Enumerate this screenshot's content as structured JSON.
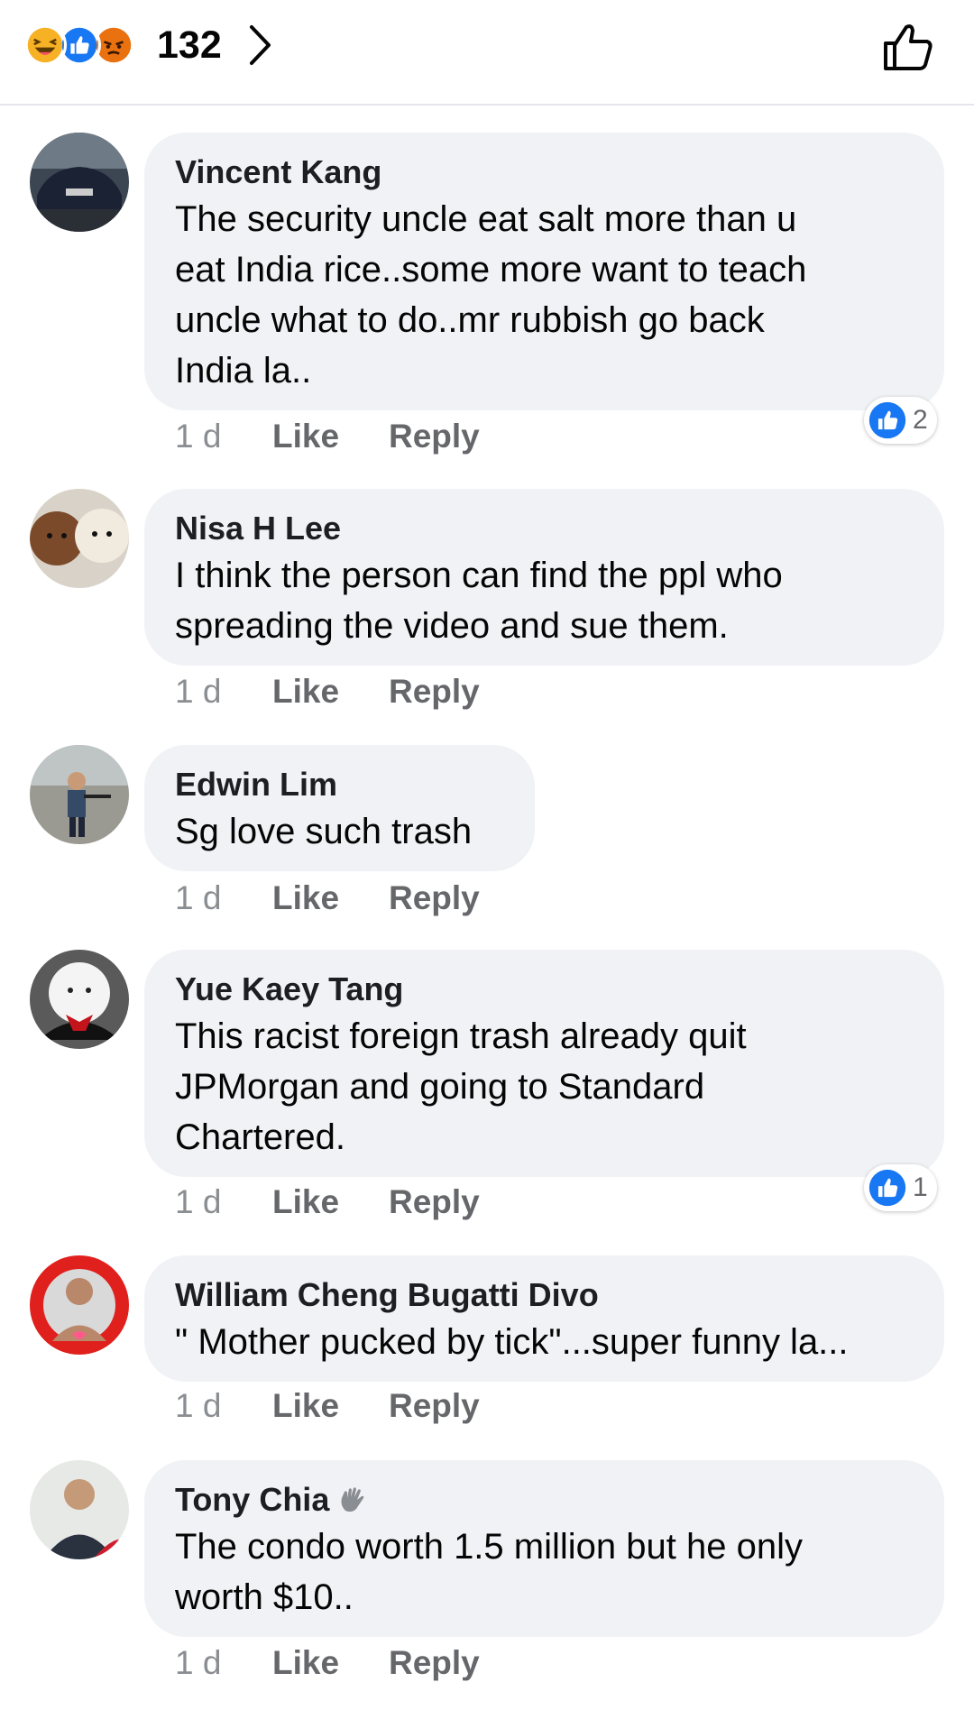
{
  "header": {
    "reaction_icons": [
      "haha-icon",
      "like-icon",
      "angry-icon"
    ],
    "reaction_count": "132"
  },
  "comments": [
    {
      "author": "Vincent Kang",
      "text": "The security uncle eat salt more than u\neat India rice..some more want to teach\nuncle what to do..mr rubbish go back\nIndia la..",
      "time": "1 d",
      "like_label": "Like",
      "reply_label": "Reply",
      "reaction_count": "2"
    },
    {
      "author": "Nisa H Lee",
      "text": "I think the person can find the ppl who\nspreading the video and sue them.",
      "time": "1 d",
      "like_label": "Like",
      "reply_label": "Reply"
    },
    {
      "author": "Edwin Lim",
      "text": "Sg love such trash",
      "time": "1 d",
      "like_label": "Like",
      "reply_label": "Reply"
    },
    {
      "author": "Yue Kaey Tang",
      "text": "This racist foreign trash already quit\nJPMorgan and going to Standard\nChartered.",
      "time": "1 d",
      "like_label": "Like",
      "reply_label": "Reply",
      "reaction_count": "1"
    },
    {
      "author": "William Cheng Bugatti Divo",
      "text": "\" Mother pucked by tick\"...super funny la...",
      "time": "1 d",
      "like_label": "Like",
      "reply_label": "Reply"
    },
    {
      "author": "Tony Chia",
      "author_badge_icon": "wave-hand-icon",
      "text": "The condo worth 1.5 million but he only\nworth $10..",
      "time": "1 d",
      "like_label": "Like",
      "reply_label": "Reply"
    }
  ],
  "colors": {
    "bubble": "#f0f2f5",
    "action_text": "#65676b",
    "like_blue": "#1877f2",
    "haha_yellow": "#f7b125",
    "angry_orange": "#e9710f"
  }
}
